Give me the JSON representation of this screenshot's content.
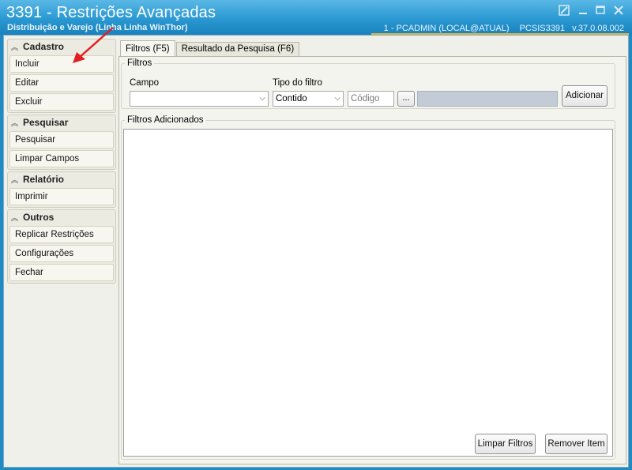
{
  "window": {
    "title": "3391 - Restrições Avançadas",
    "subtitle": "Distribuição e Varejo (Linha Linha WinThor)",
    "user": "1 - PCADMIN (LOCAL@ATUAL)",
    "routine": "PCSIS3391",
    "version": "v.37.0.08.002"
  },
  "sidebar": {
    "groups": [
      {
        "title": "Cadastro",
        "items": [
          "Incluir",
          "Editar",
          "Excluir"
        ]
      },
      {
        "title": "Pesquisar",
        "items": [
          "Pesquisar",
          "Limpar Campos"
        ]
      },
      {
        "title": "Relatório",
        "items": [
          "Imprimir"
        ]
      },
      {
        "title": "Outros",
        "items": [
          "Replicar Restrições",
          "Configurações",
          "Fechar"
        ]
      }
    ]
  },
  "tabs": [
    "Filtros (F5)",
    "Resultado da Pesquisa (F6)"
  ],
  "filters": {
    "section_title": "Filtros",
    "campo_label": "Campo",
    "campo_value": "",
    "tipo_label": "Tipo do filtro",
    "tipo_value": "Contido",
    "codigo_placeholder": "Código",
    "browse_label": "...",
    "add_button": "Adicionar"
  },
  "added": {
    "section_title": "Filtros Adicionados",
    "clear_button": "Limpar Filtros",
    "remove_button": "Remover Item"
  },
  "colors": {
    "titlebar": "#2a98d2",
    "accent_line": "#d8b64a",
    "annotation_arrow": "#e02020"
  }
}
